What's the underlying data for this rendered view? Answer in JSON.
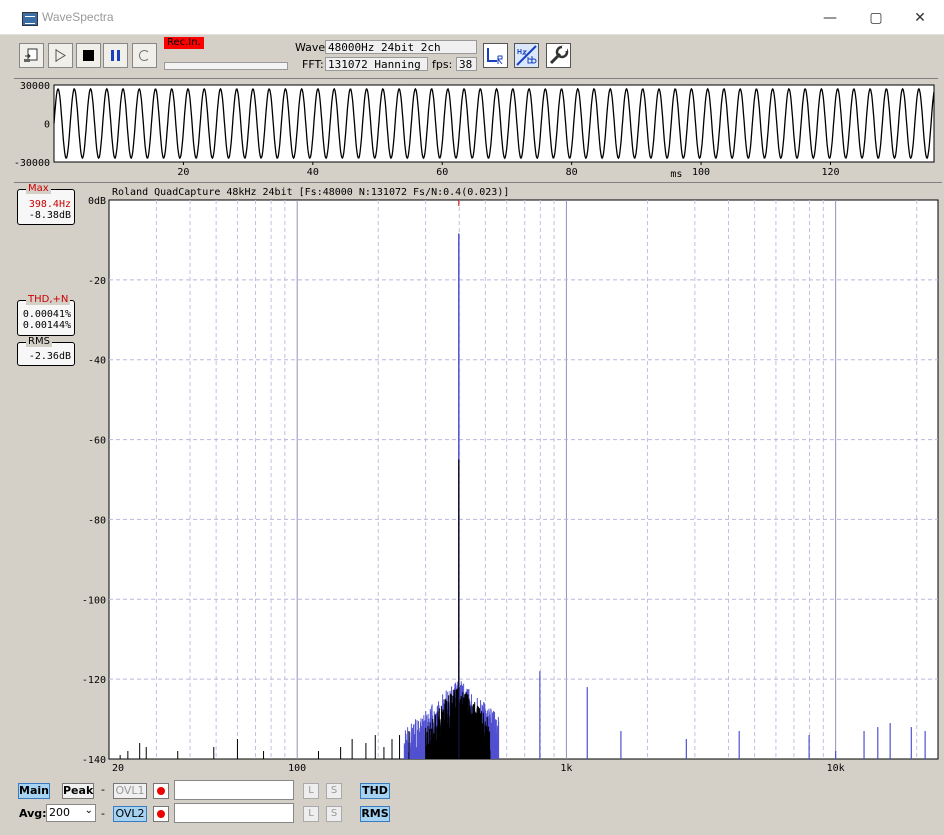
{
  "window": {
    "title": "WaveSpectra",
    "minimize": "—",
    "maximize": "▢",
    "close": "✕"
  },
  "toolbar": {
    "rec_status": "Rec.In.",
    "wave_label": "Wave:",
    "wave_value": "48000Hz 24bit 2ch",
    "fft_label": "FFT:",
    "fft_value": "131072 Hanning",
    "fps_label": "fps:",
    "fps_value": "38",
    "buttons": [
      "open-file",
      "play",
      "stop",
      "pause",
      "loop"
    ],
    "icons": [
      "lr-channel-icon",
      "hz-db-icon",
      "settings-wrench-icon"
    ]
  },
  "waveform": {
    "y_ticks": [
      "30000",
      "0",
      "-30000"
    ],
    "x_ticks": [
      "20",
      "40",
      "60",
      "80",
      "100",
      "120"
    ],
    "x_unit": "ms",
    "x_range_ms": [
      0,
      136
    ],
    "amplitude_peak": 27000,
    "frequency_hz": 398.4
  },
  "spectrum": {
    "header": "Roland QuadCapture 48kHz 24bit   [Fs:48000 N:131072 Fs/N:0.4(0.023)]",
    "y_ticks": [
      "0dB",
      "-20",
      "-40",
      "-60",
      "-80",
      "-100",
      "-120",
      "-140"
    ],
    "x_ticks": [
      "20",
      "100",
      "1k",
      "10k"
    ],
    "x_range_hz": [
      20,
      24000
    ],
    "y_range_db": [
      -140,
      0
    ],
    "fundamental_hz": 398.4,
    "fundamental_db": -8.38,
    "harmonics": [
      {
        "f": 796.8,
        "db": -118
      },
      {
        "f": 1195,
        "db": -122
      },
      {
        "f": 1594,
        "db": -133
      },
      {
        "f": 2789,
        "db": -135
      },
      {
        "f": 4383,
        "db": -133
      },
      {
        "f": 7970,
        "db": -134
      },
      {
        "f": 10000,
        "db": -138
      },
      {
        "f": 12750,
        "db": -133
      },
      {
        "f": 14340,
        "db": -132
      },
      {
        "f": 15940,
        "db": -131
      },
      {
        "f": 19100,
        "db": -132
      },
      {
        "f": 21500,
        "db": -133
      }
    ]
  },
  "readouts": {
    "max_title": "Max",
    "max_freq": "398.4Hz",
    "max_level": "-8.38dB",
    "thd_title": "THD,+N",
    "thd_value": "0.00041%",
    "thdn_value": "0.00144%",
    "rms_title": "RMS",
    "rms_value": "-2.36dB"
  },
  "bottom": {
    "main": "Main",
    "peak": "Peak",
    "dash": "-",
    "ovl1": "OVL1",
    "ovl2": "OVL2",
    "avg_label": "Avg:",
    "avg_value": "200",
    "l": "L",
    "s": "S",
    "thd": "THD",
    "rms": "RMS"
  },
  "colors": {
    "rec": "#ff0000",
    "spectrum_fill": "#5050d0",
    "spectrum_black": "#000000",
    "grid": "#a0a0d0",
    "marker": "#cc0000"
  }
}
